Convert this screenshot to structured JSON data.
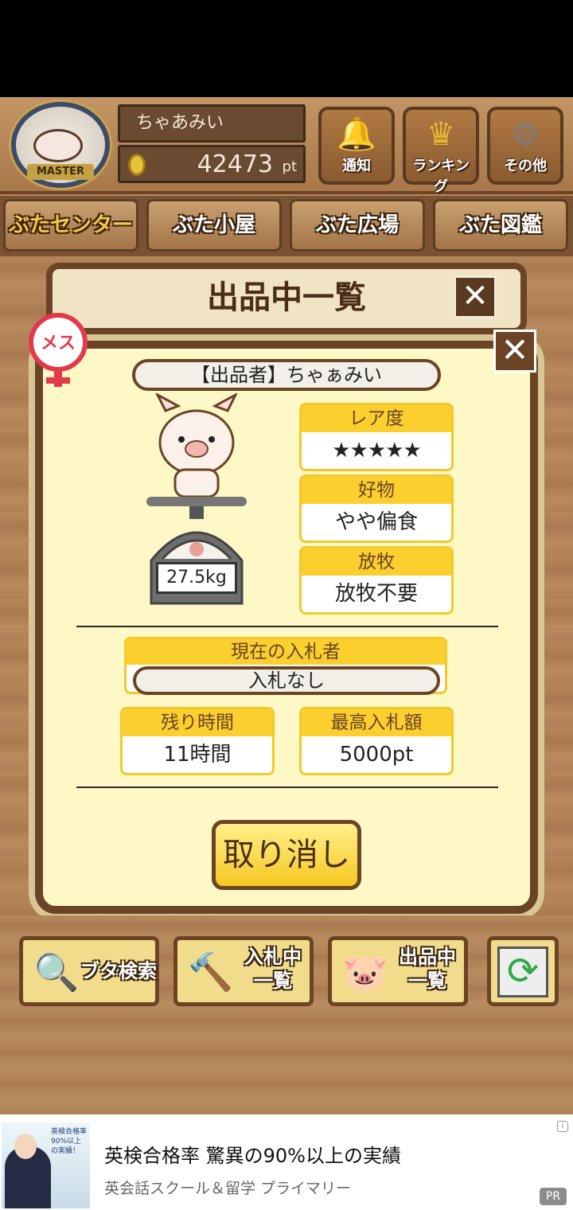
{
  "header": {
    "rank_badge_text": "MASTER",
    "player_name": "ちゃあみい",
    "points_value": "42473",
    "points_unit": "pt",
    "buttons": [
      {
        "label": "通知",
        "icon": "bell-icon"
      },
      {
        "label": "ランキング",
        "icon": "crown-icon"
      },
      {
        "label": "その他",
        "icon": "gear-icon"
      }
    ]
  },
  "tabs": [
    {
      "label": "ぶたセンター",
      "active": true
    },
    {
      "label": "ぶた小屋"
    },
    {
      "label": "ぶた広場"
    },
    {
      "label": "ぶた図鑑"
    }
  ],
  "list_panel": {
    "title": "出品中一覧"
  },
  "dialog": {
    "gender_label": "メス",
    "seller": "【出品者】ちゃぁみい",
    "weight": "27.5kg",
    "rarity": {
      "label": "レア度",
      "value": "★★★★★",
      "stars": 5
    },
    "favorite_food": {
      "label": "好物",
      "value": "やや偏食"
    },
    "grazing": {
      "label": "放牧",
      "value": "放牧不要"
    },
    "current_bidder": {
      "label": "現在の入札者",
      "value": "入札なし"
    },
    "remaining_time": {
      "label": "残り時間",
      "value": "11時間"
    },
    "highest_bid": {
      "label": "最高入札額",
      "value": "5000pt"
    },
    "cancel_label": "取り消し",
    "close_symbol": "✕"
  },
  "bottom_nav": {
    "search_label": "ブタ検索",
    "bidding_label_1": "入札中",
    "bidding_label_2": "一覧",
    "listing_label_1": "出品中",
    "listing_label_2": "一覧"
  },
  "ad": {
    "title": "英検合格率 驚異の90%以上の実績",
    "subtitle": "英会話スクール＆留学 プライマリー",
    "image_text": "英検合格率90%以上の実績！",
    "info_mark": "i",
    "pr_badge": "PR"
  },
  "colors": {
    "wood": "#b08156",
    "dark_brown": "#6b4426",
    "card_header": "#fbcf2e",
    "dialog_bg": "#fdf8c6",
    "star": "#ef7c72"
  }
}
